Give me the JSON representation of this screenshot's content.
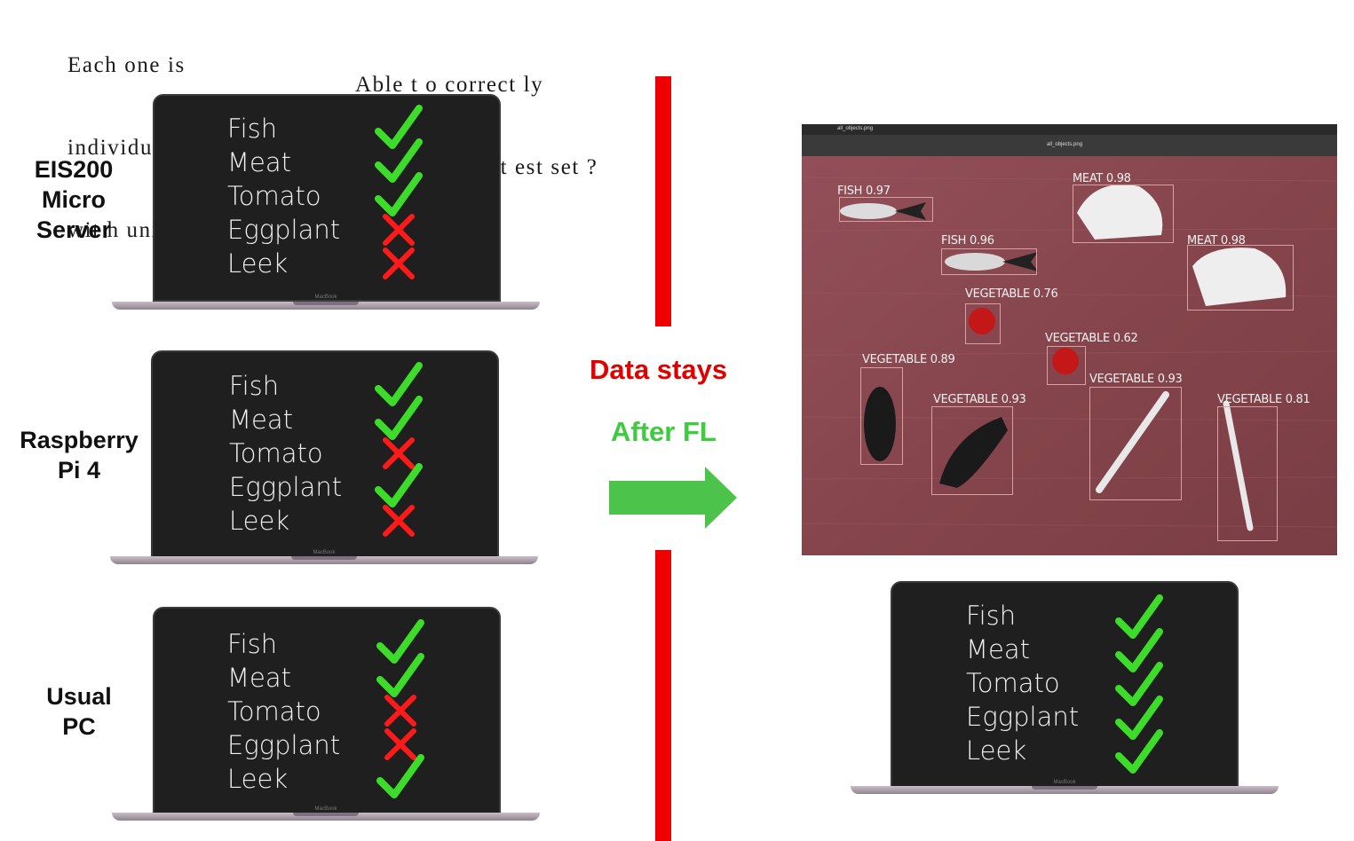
{
  "header": {
    "left_lines": [
      "Each one is",
      "individually t rained",
      "wit h unique dat aset s"
    ],
    "right_lines": [
      "Able t o correct ly",
      "classify wit h t est set ?"
    ]
  },
  "devices": [
    {
      "label_lines": [
        "EIS200",
        "Micro",
        "Server"
      ],
      "items": [
        "Fish",
        "Meat",
        "Tomato",
        "Eggplant",
        "Leek"
      ],
      "results": [
        true,
        true,
        true,
        false,
        false
      ]
    },
    {
      "label_lines": [
        "Raspberry",
        "Pi 4"
      ],
      "items": [
        "Fish",
        "Meat",
        "Tomato",
        "Eggplant",
        "Leek"
      ],
      "results": [
        true,
        true,
        false,
        true,
        false
      ]
    },
    {
      "label_lines": [
        "Usual",
        "PC"
      ],
      "items": [
        "Fish",
        "Meat",
        "Tomato",
        "Eggplant",
        "Leek"
      ],
      "results": [
        true,
        true,
        false,
        false,
        true
      ]
    }
  ],
  "final_device": {
    "items": [
      "Fish",
      "Meat",
      "Tomato",
      "Eggplant",
      "Leek"
    ],
    "results": [
      true,
      true,
      true,
      true,
      true
    ]
  },
  "laptop_brand": "MacBook",
  "middle": {
    "data_stays": "Data stays",
    "after_fl": "After FL",
    "data_stays_color": "#e00000",
    "after_fl_color": "#3dcc3d",
    "arrow_color": "#4cc44c"
  },
  "photo": {
    "window_title": "all_objects.png",
    "tab_title": "all_objects.png",
    "detections": [
      {
        "label": "FISH 0.97"
      },
      {
        "label": "MEAT 0.98"
      },
      {
        "label": "FISH 0.96"
      },
      {
        "label": "MEAT 0.98"
      },
      {
        "label": "VEGETABLE 0.76"
      },
      {
        "label": "VEGETABLE 0.62"
      },
      {
        "label": "VEGETABLE 0.89"
      },
      {
        "label": "VEGETABLE 0.93"
      },
      {
        "label": "VEGETABLE 0.93"
      },
      {
        "label": "VEGETABLE 0.81"
      }
    ]
  },
  "colors": {
    "check": "#3ddc2a",
    "cross": "#ff1a1a",
    "bar": "#ee0000"
  }
}
